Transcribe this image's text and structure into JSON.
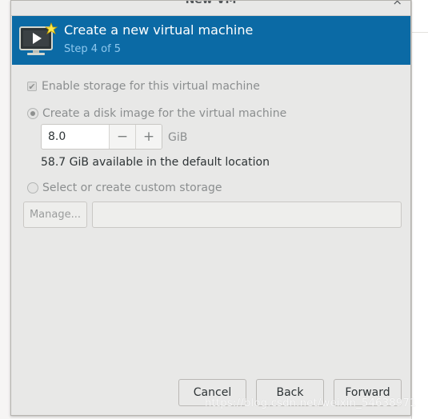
{
  "window": {
    "title": "New VM",
    "close_label": "×"
  },
  "header": {
    "title": "Create a new virtual machine",
    "step": "Step 4 of 5"
  },
  "storage": {
    "enable_label": "Enable storage for this virtual machine",
    "enable_checked": true,
    "disk_image_label": "Create a disk image for the virtual machine",
    "disk_image_selected": true,
    "size_value": "8.0",
    "minus_label": "−",
    "plus_label": "+",
    "unit": "GiB",
    "available_text": "58.7 GiB available in the default location",
    "custom_label": "Select or create custom storage",
    "custom_selected": false,
    "manage_label": "Manage...",
    "path_value": ""
  },
  "footer": {
    "cancel": "Cancel",
    "back": "Back",
    "forward": "Forward"
  },
  "watermark": "https://blog.csdn.net/weixin_54638971",
  "colors": {
    "header_bg": "#0b6aa5",
    "header_subtitle": "#8ec8ee",
    "window_bg": "#e8e8e7"
  }
}
